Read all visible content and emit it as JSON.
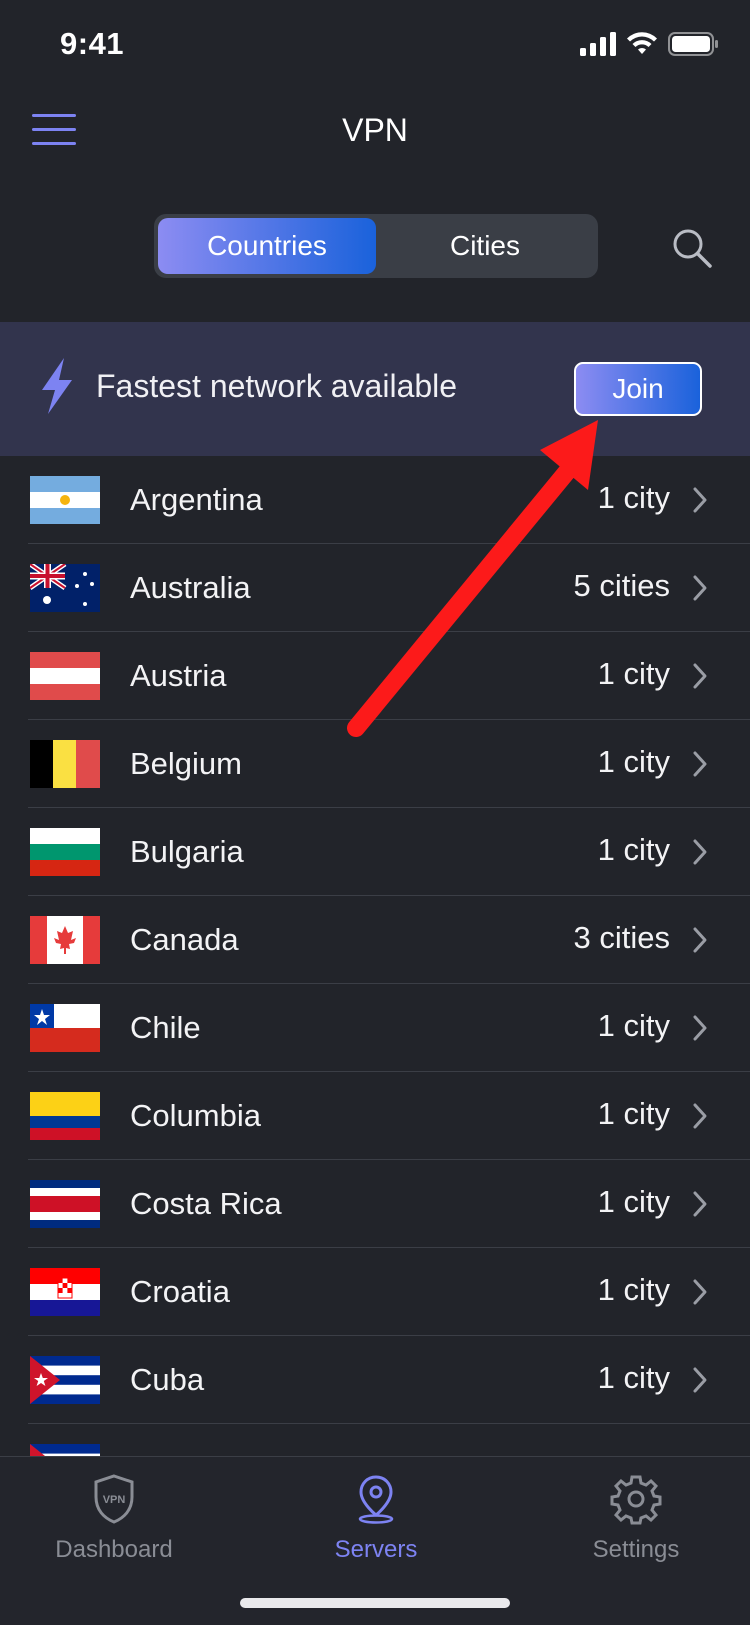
{
  "status_bar": {
    "time": "9:41"
  },
  "nav": {
    "title": "VPN"
  },
  "segment": {
    "countries_label": "Countries",
    "cities_label": "Cities",
    "selected": "Countries"
  },
  "banner": {
    "text": "Fastest network available",
    "join_label": "Join"
  },
  "countries": [
    {
      "name": "Argentina",
      "count": "1 city",
      "flag": "argentina"
    },
    {
      "name": "Australia",
      "count": "5 cities",
      "flag": "australia"
    },
    {
      "name": "Austria",
      "count": "1 city",
      "flag": "austria"
    },
    {
      "name": "Belgium",
      "count": "1 city",
      "flag": "belgium"
    },
    {
      "name": "Bulgaria",
      "count": "1 city",
      "flag": "bulgaria"
    },
    {
      "name": "Canada",
      "count": "3 cities",
      "flag": "canada"
    },
    {
      "name": "Chile",
      "count": "1 city",
      "flag": "chile"
    },
    {
      "name": "Columbia",
      "count": "1 city",
      "flag": "colombia"
    },
    {
      "name": "Costa Rica",
      "count": "1 city",
      "flag": "costa-rica"
    },
    {
      "name": "Croatia",
      "count": "1 city",
      "flag": "croatia"
    },
    {
      "name": "Cuba",
      "count": "1 city",
      "flag": "cuba"
    },
    {
      "name": "",
      "count": "",
      "flag": "cuba"
    }
  ],
  "tabs": [
    {
      "label": "Dashboard",
      "icon": "vpn-shield-icon",
      "active": false
    },
    {
      "label": "Servers",
      "icon": "location-pin-icon",
      "active": true
    },
    {
      "label": "Settings",
      "icon": "gear-icon",
      "active": false
    }
  ],
  "colors": {
    "background": "#22242a",
    "accent": "#7d83f2",
    "banner": "#32344d",
    "annotation_arrow": "#fc1a1a",
    "inactive": "#8a8d95"
  }
}
